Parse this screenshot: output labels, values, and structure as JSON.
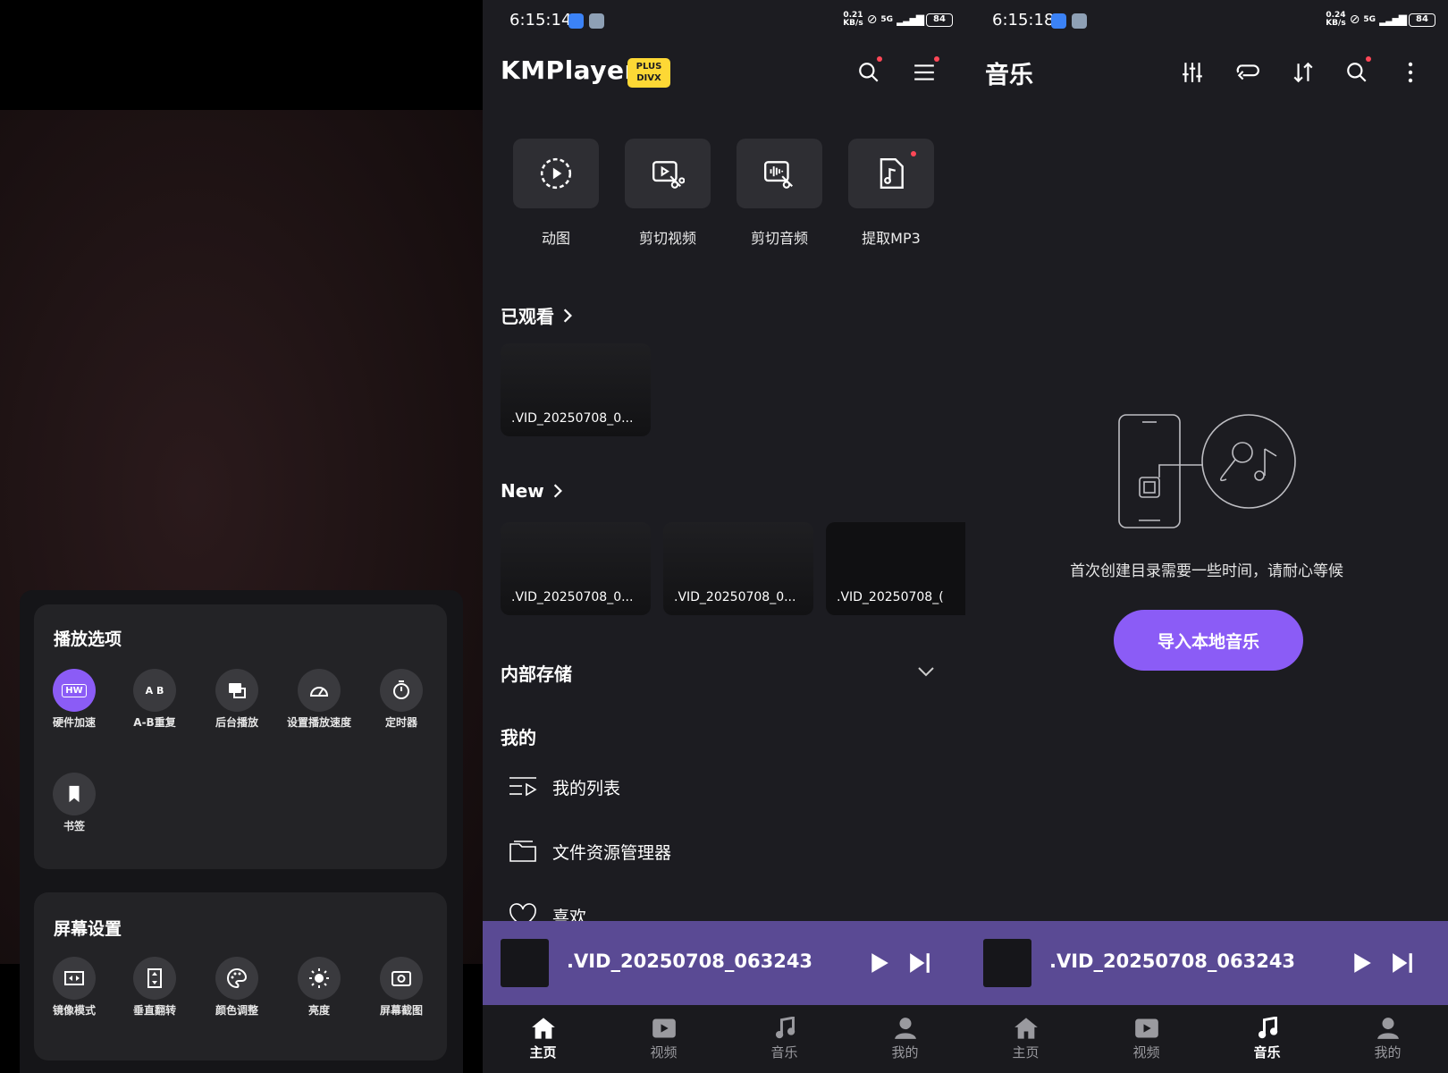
{
  "status_left": {
    "time": "6:15:14",
    "speed_top": "0.21",
    "speed_unit": "KB/s",
    "network": "5G",
    "battery": "84"
  },
  "status_right": {
    "time": "6:15:18",
    "speed_top": "0.24",
    "speed_unit": "KB/s",
    "network": "5G",
    "battery": "84"
  },
  "playback_options": {
    "title": "播放选项",
    "items": [
      {
        "label": "硬件加速",
        "icon": "hw-icon",
        "icon_text": "HW",
        "active": true
      },
      {
        "label": "A-B重复",
        "icon": "ab-repeat-icon",
        "icon_text": "A B"
      },
      {
        "label": "后台播放",
        "icon": "background-play-icon"
      },
      {
        "label": "设置播放速度",
        "icon": "speed-icon"
      },
      {
        "label": "定时器",
        "icon": "timer-icon"
      },
      {
        "label": "书签",
        "icon": "bookmark-icon"
      }
    ]
  },
  "screen_settings": {
    "title": "屏幕设置",
    "items": [
      {
        "label": "镜像模式",
        "icon": "mirror-icon"
      },
      {
        "label": "垂直翻转",
        "icon": "vertical-flip-icon"
      },
      {
        "label": "颜色调整",
        "icon": "palette-icon"
      },
      {
        "label": "亮度",
        "icon": "brightness-icon"
      },
      {
        "label": "屏幕截图",
        "icon": "screenshot-icon"
      }
    ]
  },
  "home": {
    "logo": "KMPlayer",
    "badge_top": "PLUS",
    "badge_bottom": "DIVX",
    "tools": [
      {
        "label": "动图",
        "icon": "gif-icon"
      },
      {
        "label": "剪切视频",
        "icon": "cut-video-icon"
      },
      {
        "label": "剪切音频",
        "icon": "cut-audio-icon"
      },
      {
        "label": "提取MP3",
        "icon": "extract-mp3-icon"
      }
    ],
    "watched_title": "已观看",
    "watched": [
      ".VID_20250708_0..."
    ],
    "new_title": "New",
    "new_items": [
      ".VID_20250708_0...",
      ".VID_20250708_0...",
      ".VID_20250708_("
    ],
    "storage_title": "内部存储",
    "mine_title": "我的",
    "mine_items": [
      {
        "label": "我的列表",
        "icon": "playlist-icon"
      },
      {
        "label": "文件资源管理器",
        "icon": "folder-icon"
      },
      {
        "label": "喜欢",
        "icon": "heart-icon"
      }
    ]
  },
  "music": {
    "title": "音乐",
    "empty_message": "首次创建目录需要一些时间，请耐心等候",
    "import_label": "导入本地音乐"
  },
  "mini_player": {
    "title": ".VID_20250708_063243"
  },
  "nav": {
    "home": "主页",
    "video": "视频",
    "music": "音乐",
    "mine": "我的"
  },
  "colors": {
    "accent": "#8b5cf6",
    "player_bar": "#5a4a94",
    "badge": "#fdd835",
    "background": "#1c1c21"
  }
}
